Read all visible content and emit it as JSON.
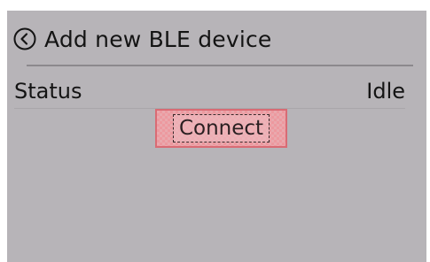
{
  "header": {
    "back_icon": "back-circle-chevron-icon",
    "title": "Add new BLE device"
  },
  "status": {
    "label": "Status",
    "value": "Idle"
  },
  "actions": {
    "connect_label": "Connect"
  },
  "colors": {
    "screen_background": "#b7b4b8",
    "text": "#141414",
    "button_highlight": "#e9a8ad",
    "button_border": "#d96b74"
  }
}
